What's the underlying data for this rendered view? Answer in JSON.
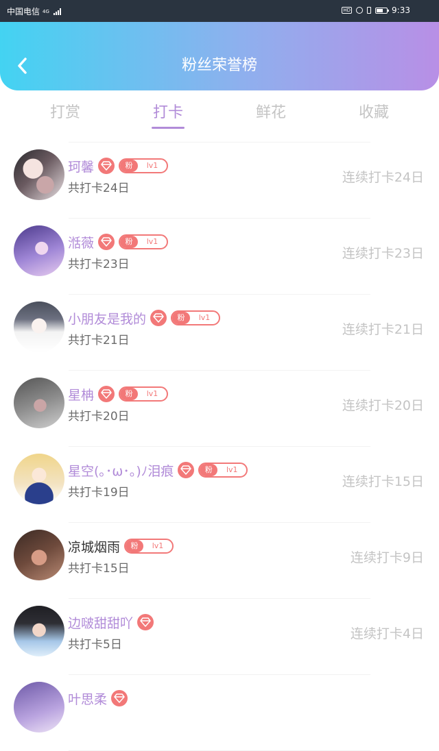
{
  "status_bar": {
    "carrier": "中国电信",
    "network": "4G",
    "hd": "HD",
    "time": "9:33"
  },
  "header": {
    "title": "粉丝荣誉榜",
    "back_icon": "chevron-left-icon"
  },
  "tabs": [
    {
      "label": "打赏",
      "active": false
    },
    {
      "label": "打卡",
      "active": true
    },
    {
      "label": "鲜花",
      "active": false
    },
    {
      "label": "收藏",
      "active": false
    }
  ],
  "colors": {
    "accent": "#b18bd8",
    "badge": "#f27878",
    "muted": "#c4c4c4",
    "header_from": "#43d3f2",
    "header_to": "#b88fe6"
  },
  "fans": [
    {
      "name": "珂馨",
      "diamond": true,
      "badge_label": "粉",
      "badge_level": "lv1",
      "total": "共打卡24日",
      "streak": "连续打卡24日",
      "name_dark": false,
      "avatar": "avatar-dark-hair-1"
    },
    {
      "name": "湉薇",
      "diamond": true,
      "badge_label": "粉",
      "badge_level": "lv1",
      "total": "共打卡23日",
      "streak": "连续打卡23日",
      "name_dark": false,
      "avatar": "avatar-purple-girl"
    },
    {
      "name": "小朋友是我的",
      "diamond": true,
      "badge_label": "粉",
      "badge_level": "lv1",
      "total": "共打卡21日",
      "streak": "连续打卡21日",
      "name_dark": false,
      "avatar": "avatar-anime-boy"
    },
    {
      "name": "星柟",
      "diamond": true,
      "badge_label": "粉",
      "badge_level": "lv1",
      "total": "共打卡20日",
      "streak": "连续打卡20日",
      "name_dark": false,
      "avatar": "avatar-grey-girl"
    },
    {
      "name": "星空(｡･ω･｡)ﾉ泪痕",
      "diamond": true,
      "badge_label": "粉",
      "badge_level": "lv1",
      "total": "共打卡19日",
      "streak": "连续打卡15日",
      "name_dark": false,
      "avatar": "avatar-blonde-anime"
    },
    {
      "name": "凉城烟雨",
      "diamond": false,
      "badge_label": "粉",
      "badge_level": "lv1",
      "total": "共打卡15日",
      "streak": "连续打卡9日",
      "name_dark": true,
      "avatar": "avatar-brown-girl"
    },
    {
      "name": "边啵甜甜吖",
      "diamond": true,
      "badge_label": "",
      "badge_level": "",
      "total": "共打卡5日",
      "streak": "连续打卡4日",
      "name_dark": false,
      "avatar": "avatar-boy-blue"
    },
    {
      "name": "叶思柔",
      "diamond": true,
      "badge_label": "",
      "badge_level": "",
      "total": "",
      "streak": "",
      "name_dark": false,
      "avatar": "avatar-purple-2"
    }
  ]
}
